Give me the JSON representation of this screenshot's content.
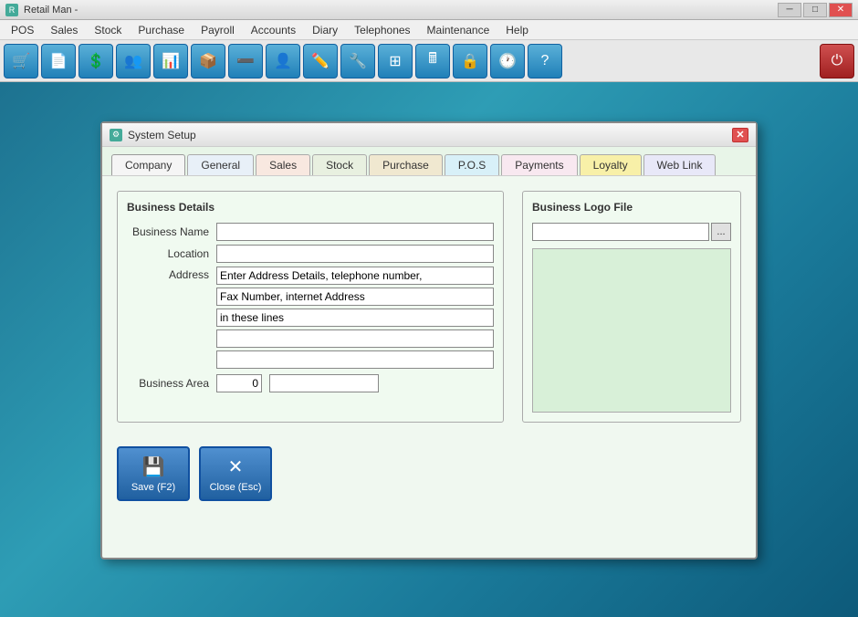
{
  "app": {
    "title": "Retail Man -",
    "icon": "R"
  },
  "titlebar": {
    "minimize": "─",
    "maximize": "□",
    "close": "✕"
  },
  "menubar": {
    "items": [
      "POS",
      "Sales",
      "Stock",
      "Purchase",
      "Payroll",
      "Accounts",
      "Diary",
      "Telephones",
      "Maintenance",
      "Help"
    ]
  },
  "toolbar": {
    "buttons": [
      {
        "name": "pos-icon",
        "icon": "🛒"
      },
      {
        "name": "notes-icon",
        "icon": "📄"
      },
      {
        "name": "dollar-icon",
        "icon": "💲"
      },
      {
        "name": "people-icon",
        "icon": "👥"
      },
      {
        "name": "chart-icon",
        "icon": "📊"
      },
      {
        "name": "box-icon",
        "icon": "📦"
      },
      {
        "name": "minus-icon",
        "icon": "➖"
      },
      {
        "name": "person-icon",
        "icon": "👤"
      },
      {
        "name": "edit-icon",
        "icon": "✏️"
      },
      {
        "name": "tools-icon",
        "icon": "🔧"
      },
      {
        "name": "grid-icon",
        "icon": "⊞"
      },
      {
        "name": "calc-icon",
        "icon": "🖩"
      },
      {
        "name": "lock-icon",
        "icon": "🔒"
      },
      {
        "name": "clock-icon",
        "icon": "🕐"
      },
      {
        "name": "help-icon",
        "icon": "?"
      },
      {
        "name": "power-icon",
        "icon": "⏻"
      }
    ]
  },
  "dialog": {
    "title": "System Setup",
    "icon": "⚙",
    "tabs": [
      {
        "id": "company",
        "label": "Company",
        "active": true,
        "class": "company"
      },
      {
        "id": "general",
        "label": "General",
        "class": "general"
      },
      {
        "id": "sales",
        "label": "Sales",
        "class": "sales"
      },
      {
        "id": "stock",
        "label": "Stock",
        "class": "stock"
      },
      {
        "id": "purchase",
        "label": "Purchase",
        "class": "purchase"
      },
      {
        "id": "pos",
        "label": "P.O.S",
        "class": "pos"
      },
      {
        "id": "payments",
        "label": "Payments",
        "class": "payments"
      },
      {
        "id": "loyalty",
        "label": "Loyalty",
        "class": "loyalty"
      },
      {
        "id": "weblink",
        "label": "Web Link",
        "class": "weblink"
      }
    ],
    "business_details": {
      "section_title": "Business Details",
      "business_name_label": "Business Name",
      "business_name_value": "",
      "location_label": "Location",
      "location_value": "",
      "address_label": "Address",
      "address_lines": [
        "Enter Address Details, telephone number,",
        "Fax Number, internet Address",
        "in these lines",
        "",
        ""
      ],
      "business_area_label": "Business Area",
      "business_area_value": "0",
      "business_area_extra": ""
    },
    "logo": {
      "section_title": "Business Logo File",
      "file_value": "",
      "browse_label": "..."
    },
    "footer": {
      "save_label": "Save (F2)",
      "save_icon": "💾",
      "close_label": "Close (Esc)",
      "close_icon": "✕"
    }
  }
}
